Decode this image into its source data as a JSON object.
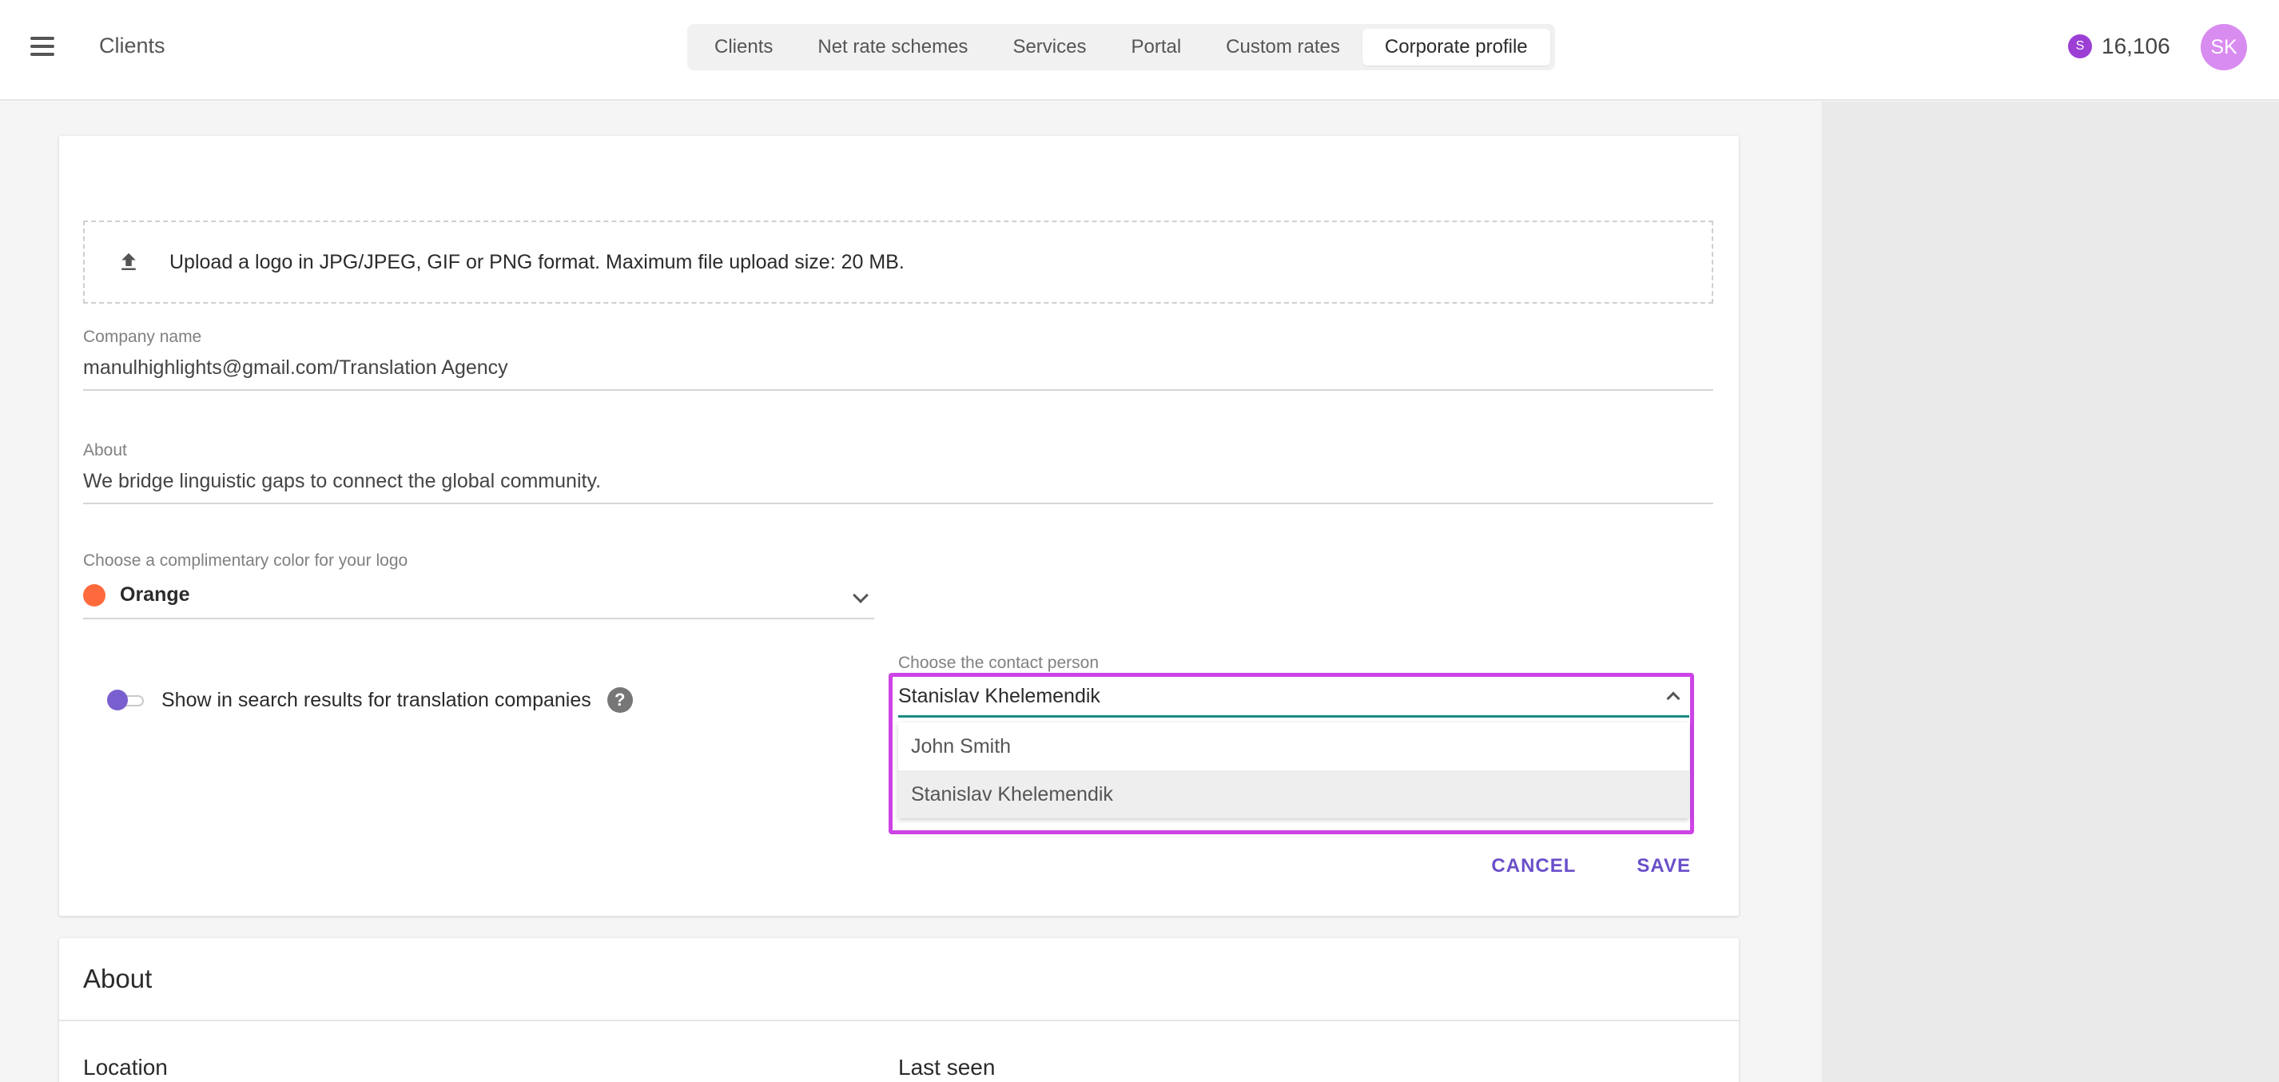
{
  "header": {
    "app_title": "Clients",
    "tabs": [
      {
        "label": "Clients"
      },
      {
        "label": "Net rate schemes"
      },
      {
        "label": "Services"
      },
      {
        "label": "Portal"
      },
      {
        "label": "Custom rates"
      },
      {
        "label": "Corporate profile"
      }
    ],
    "active_tab": "Corporate profile",
    "credit_symbol": "S",
    "credits": "16,106",
    "avatar_initials": "SK"
  },
  "profile": {
    "upload_text": "Upload a logo in JPG/JPEG, GIF or PNG format. Maximum file upload size: 20 MB.",
    "company_name_label": "Company name",
    "company_name_value": "manulhighlights@gmail.com/Translation Agency",
    "about_label": "About",
    "about_value": "We bridge linguistic gaps to connect the global community.",
    "color_label": "Choose a complimentary color for your logo",
    "color_value": "Orange",
    "color_hex": "#ff6a3d",
    "toggle_label": "Show in search results for translation companies",
    "toggle_on": true,
    "help_symbol": "?",
    "contact_label": "Choose the contact person",
    "contact_value": "Stanislav Khelemendik",
    "contact_options": [
      {
        "label": "John Smith"
      },
      {
        "label": "Stanislav Khelemendik"
      }
    ],
    "cancel_label": "CANCEL",
    "save_label": "SAVE"
  },
  "about_section": {
    "title": "About",
    "location_label": "Location",
    "last_seen_label": "Last seen"
  },
  "colors": {
    "accent": "#6a4fc9",
    "highlight": "#cc44e6",
    "input_underline": "#1a8a82"
  }
}
